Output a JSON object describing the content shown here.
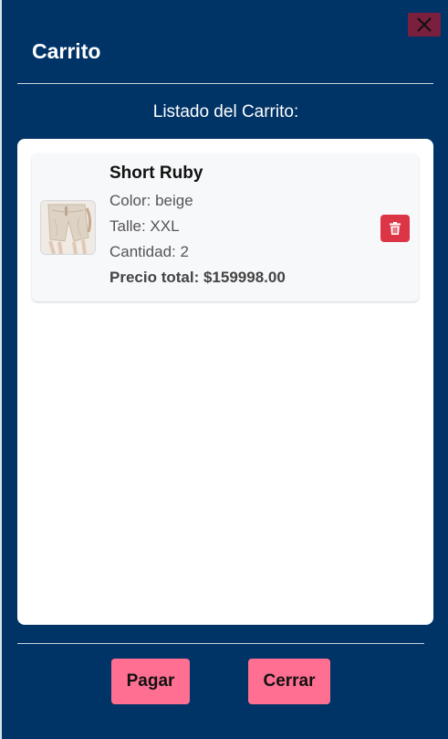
{
  "modal": {
    "title": "Carrito",
    "subtitle": "Listado del Carrito:"
  },
  "cart": {
    "items": [
      {
        "name": "Short Ruby",
        "color": "Color: beige",
        "size": "Talle: XXL",
        "quantity": "Cantidad: 2",
        "total": "Precio total: $159998.00",
        "thumb_icon": "shorts-photo"
      }
    ]
  },
  "footer": {
    "pay_label": "Pagar",
    "close_label": "Cerrar"
  },
  "icons": {
    "close": "close-icon",
    "delete": "trash-icon"
  },
  "colors": {
    "panel_bg": "#003366",
    "close_button": "#7a1f3d",
    "delete_button": "#dc3545",
    "action_button": "#ff6f91"
  }
}
